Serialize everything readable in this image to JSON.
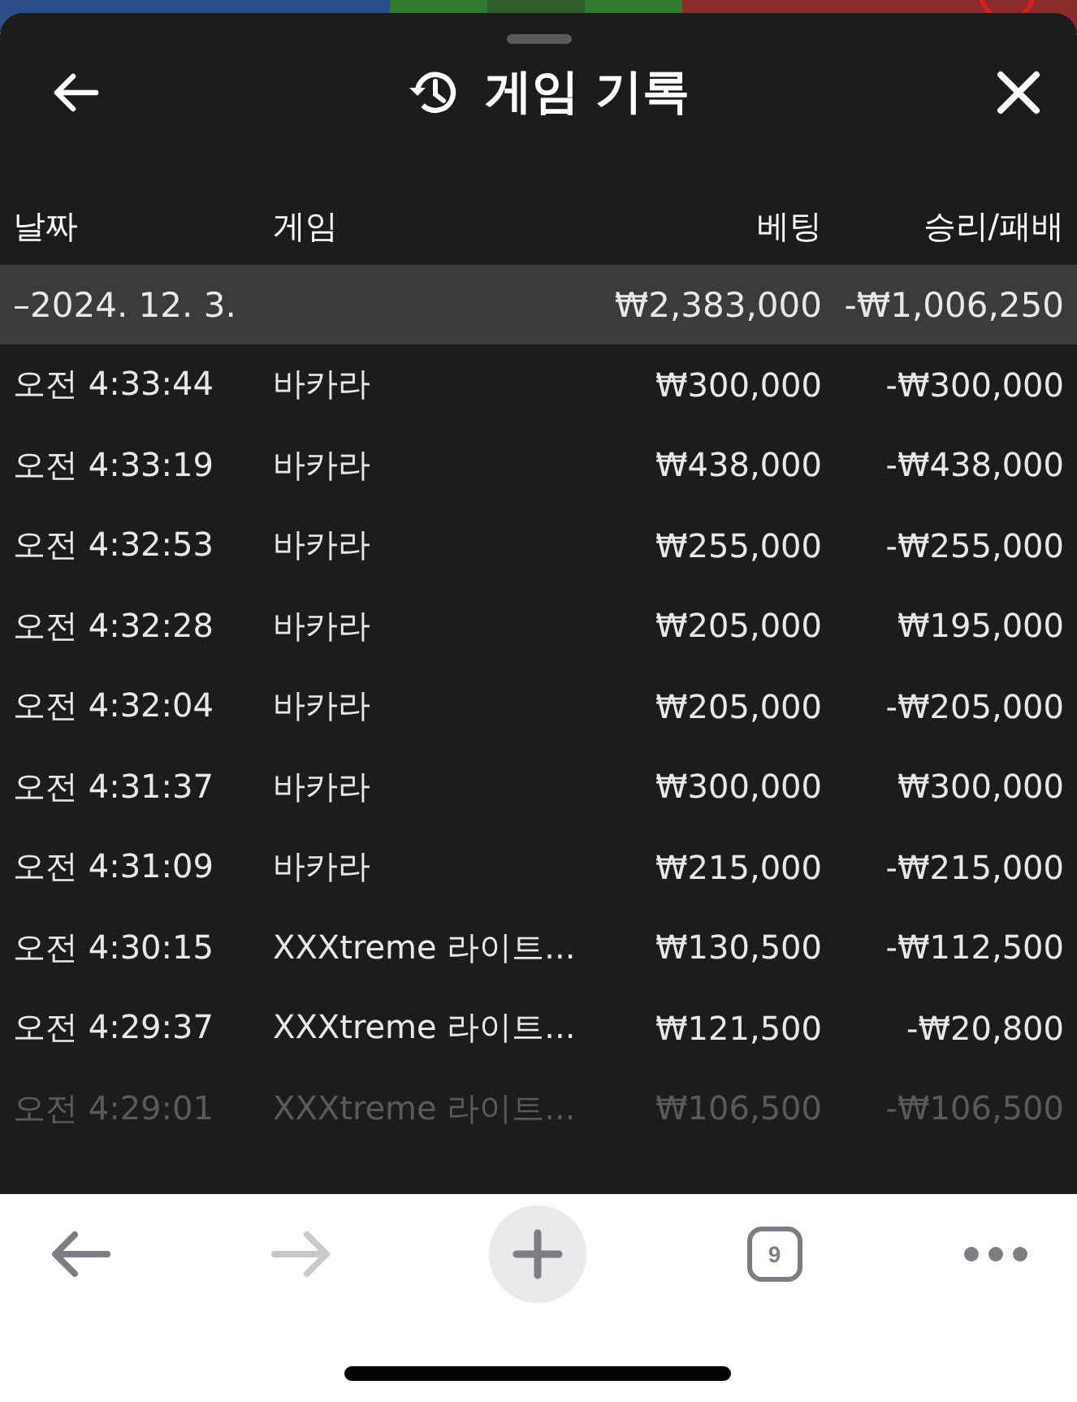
{
  "sheet": {
    "title": "게임 기록"
  },
  "columns": [
    "날짜",
    "게임",
    "베팅",
    "승리/패배"
  ],
  "day_summary": {
    "date": "–2024. 12. 3.",
    "bet": "₩2,383,000",
    "result": "-₩1,006,250"
  },
  "rows": [
    {
      "time": "오전 4:33:44",
      "game": "바카라",
      "bet": "₩300,000",
      "result": "-₩300,000",
      "faded": false
    },
    {
      "time": "오전 4:33:19",
      "game": "바카라",
      "bet": "₩438,000",
      "result": "-₩438,000",
      "faded": false
    },
    {
      "time": "오전 4:32:53",
      "game": "바카라",
      "bet": "₩255,000",
      "result": "-₩255,000",
      "faded": false
    },
    {
      "time": "오전 4:32:28",
      "game": "바카라",
      "bet": "₩205,000",
      "result": "₩195,000",
      "faded": false
    },
    {
      "time": "오전 4:32:04",
      "game": "바카라",
      "bet": "₩205,000",
      "result": "-₩205,000",
      "faded": false
    },
    {
      "time": "오전 4:31:37",
      "game": "바카라",
      "bet": "₩300,000",
      "result": "₩300,000",
      "faded": false
    },
    {
      "time": "오전 4:31:09",
      "game": "바카라",
      "bet": "₩215,000",
      "result": "-₩215,000",
      "faded": false
    },
    {
      "time": "오전 4:30:15",
      "game": "XXXtreme 라이트...",
      "bet": "₩130,500",
      "result": "-₩112,500",
      "faded": false
    },
    {
      "time": "오전 4:29:37",
      "game": "XXXtreme 라이트...",
      "bet": "₩121,500",
      "result": "-₩20,800",
      "faded": false
    },
    {
      "time": "오전 4:29:01",
      "game": "XXXtreme 라이트...",
      "bet": "₩106,500",
      "result": "-₩106,500",
      "faded": true
    }
  ],
  "browser_toolbar": {
    "back_disabled": false,
    "forward_disabled": true,
    "tab_count": "9"
  }
}
